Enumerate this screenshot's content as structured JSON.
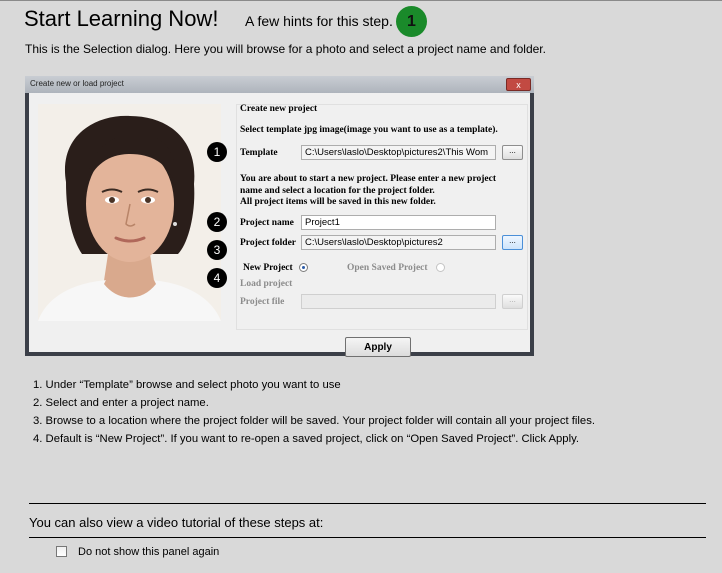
{
  "header": {
    "title": "Start Learning Now!",
    "subtitle": "A few hints for this step.",
    "step_number": "1",
    "intro": "This is the Selection dialog. Here you will browse for a photo and select a project name and folder."
  },
  "dialog": {
    "window_title": "Create new or load project",
    "close_glyph": "x",
    "create_header": "Create new project",
    "template_hint": "Select template jpg image(image you want to use as a template).",
    "template_label": "Template",
    "template_value": "C:\\Users\\laslo\\Desktop\\pictures2\\This Wom",
    "browse_label": "...",
    "about_text_1": "You are about to start a new project. Please enter a new project",
    "about_text_2": "name and select a location for the project folder.",
    "about_text_3": "All project items will be saved in this new folder.",
    "project_name_label": "Project name",
    "project_name_value": "Project1",
    "project_folder_label": "Project folder",
    "project_folder_value": "C:\\Users\\laslo\\Desktop\\pictures2",
    "radio_new_label": "New Project",
    "radio_open_label": "Open Saved Project",
    "selected_mode": "New Project",
    "load_header": "Load project",
    "project_file_label": "Project file",
    "project_file_value": "",
    "apply_label": "Apply"
  },
  "callouts": [
    "1",
    "2",
    "3",
    "4"
  ],
  "instructions": [
    "1. Under “Template” browse and select photo you want to use",
    "2. Select and enter a project name.",
    "3. Browse to a location where the project folder will be saved. Your project folder will contain all your project files.",
    "4. Default is “New Project”. If you want to re-open a saved project, click on “Open Saved Project”. Click Apply."
  ],
  "footer": {
    "video_text": "You can also view a video tutorial of these steps at:",
    "checkbox_label": "Do not show this panel again",
    "checkbox_checked": false
  },
  "colors": {
    "badge": "#1a8a2a",
    "page_bg": "#d9d9d9",
    "dialog_frame": "#3b3f48",
    "close_button": "#c24a42"
  },
  "icons": {
    "photo": "portrait-photo",
    "close": "close-icon"
  }
}
